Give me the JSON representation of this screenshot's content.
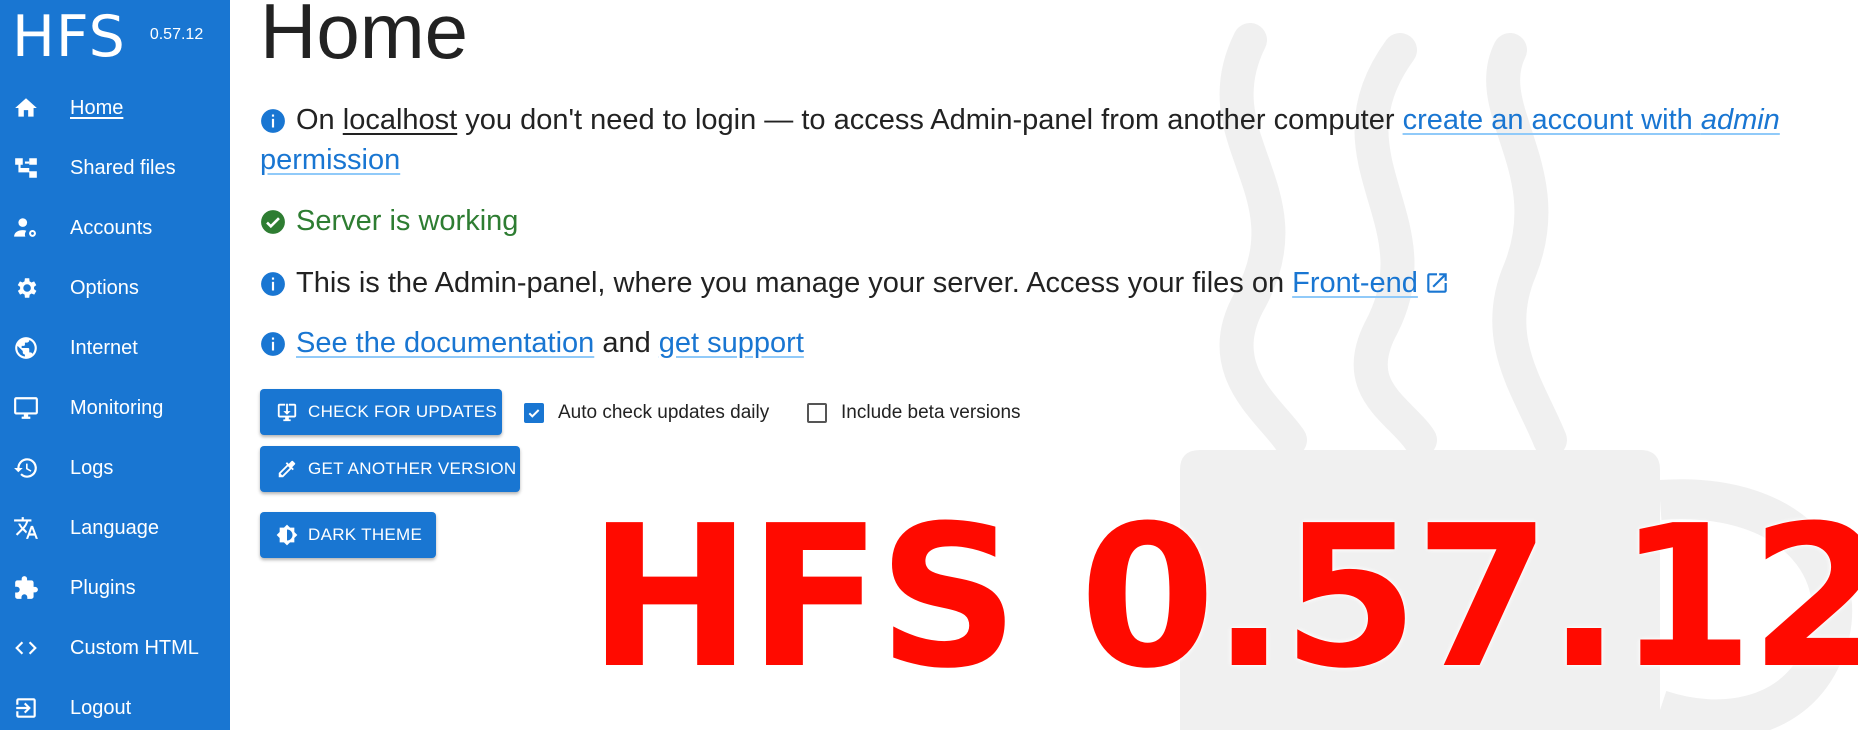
{
  "app": {
    "name": "HFS",
    "version": "0.57.12"
  },
  "sidebar": {
    "items": [
      {
        "label": "Home",
        "icon": "home-icon",
        "active": true
      },
      {
        "label": "Shared files",
        "icon": "tree-icon"
      },
      {
        "label": "Accounts",
        "icon": "account-settings-icon"
      },
      {
        "label": "Options",
        "icon": "gear-icon"
      },
      {
        "label": "Internet",
        "icon": "globe-icon"
      },
      {
        "label": "Monitoring",
        "icon": "monitor-icon"
      },
      {
        "label": "Logs",
        "icon": "history-icon"
      },
      {
        "label": "Language",
        "icon": "translate-icon"
      },
      {
        "label": "Plugins",
        "icon": "puzzle-icon"
      },
      {
        "label": "Custom HTML",
        "icon": "code-icon"
      },
      {
        "label": "Logout",
        "icon": "logout-icon"
      }
    ]
  },
  "main": {
    "title": "Home",
    "messages": {
      "login": {
        "prefix": "On ",
        "localhost": "localhost",
        "middle": " you don't need to login — to access Admin-panel from another computer ",
        "link_start": "create an account with ",
        "link_em": "admin",
        "link_end": "permission"
      },
      "status": "Server is working",
      "admin": {
        "text": "This is the Admin-panel, where you manage your server. Access your files on ",
        "link": "Front-end"
      },
      "docs": {
        "link1": "See the documentation",
        "middle": " and ",
        "link2": "get support"
      }
    },
    "buttons": {
      "check_updates": "CHECK FOR UPDATES",
      "another_version": "GET ANOTHER VERSION",
      "dark_theme": "DARK THEME"
    },
    "checkboxes": {
      "auto_check": {
        "label": "Auto check updates daily",
        "checked": true
      },
      "beta": {
        "label": "Include beta versions",
        "checked": false
      }
    }
  },
  "overlay": {
    "text": "HFS 0.57.12"
  },
  "colors": {
    "sidebar": "#1976d2",
    "accent": "#1976d2",
    "success": "#2e7d32",
    "overlay": "#ff0a00"
  }
}
